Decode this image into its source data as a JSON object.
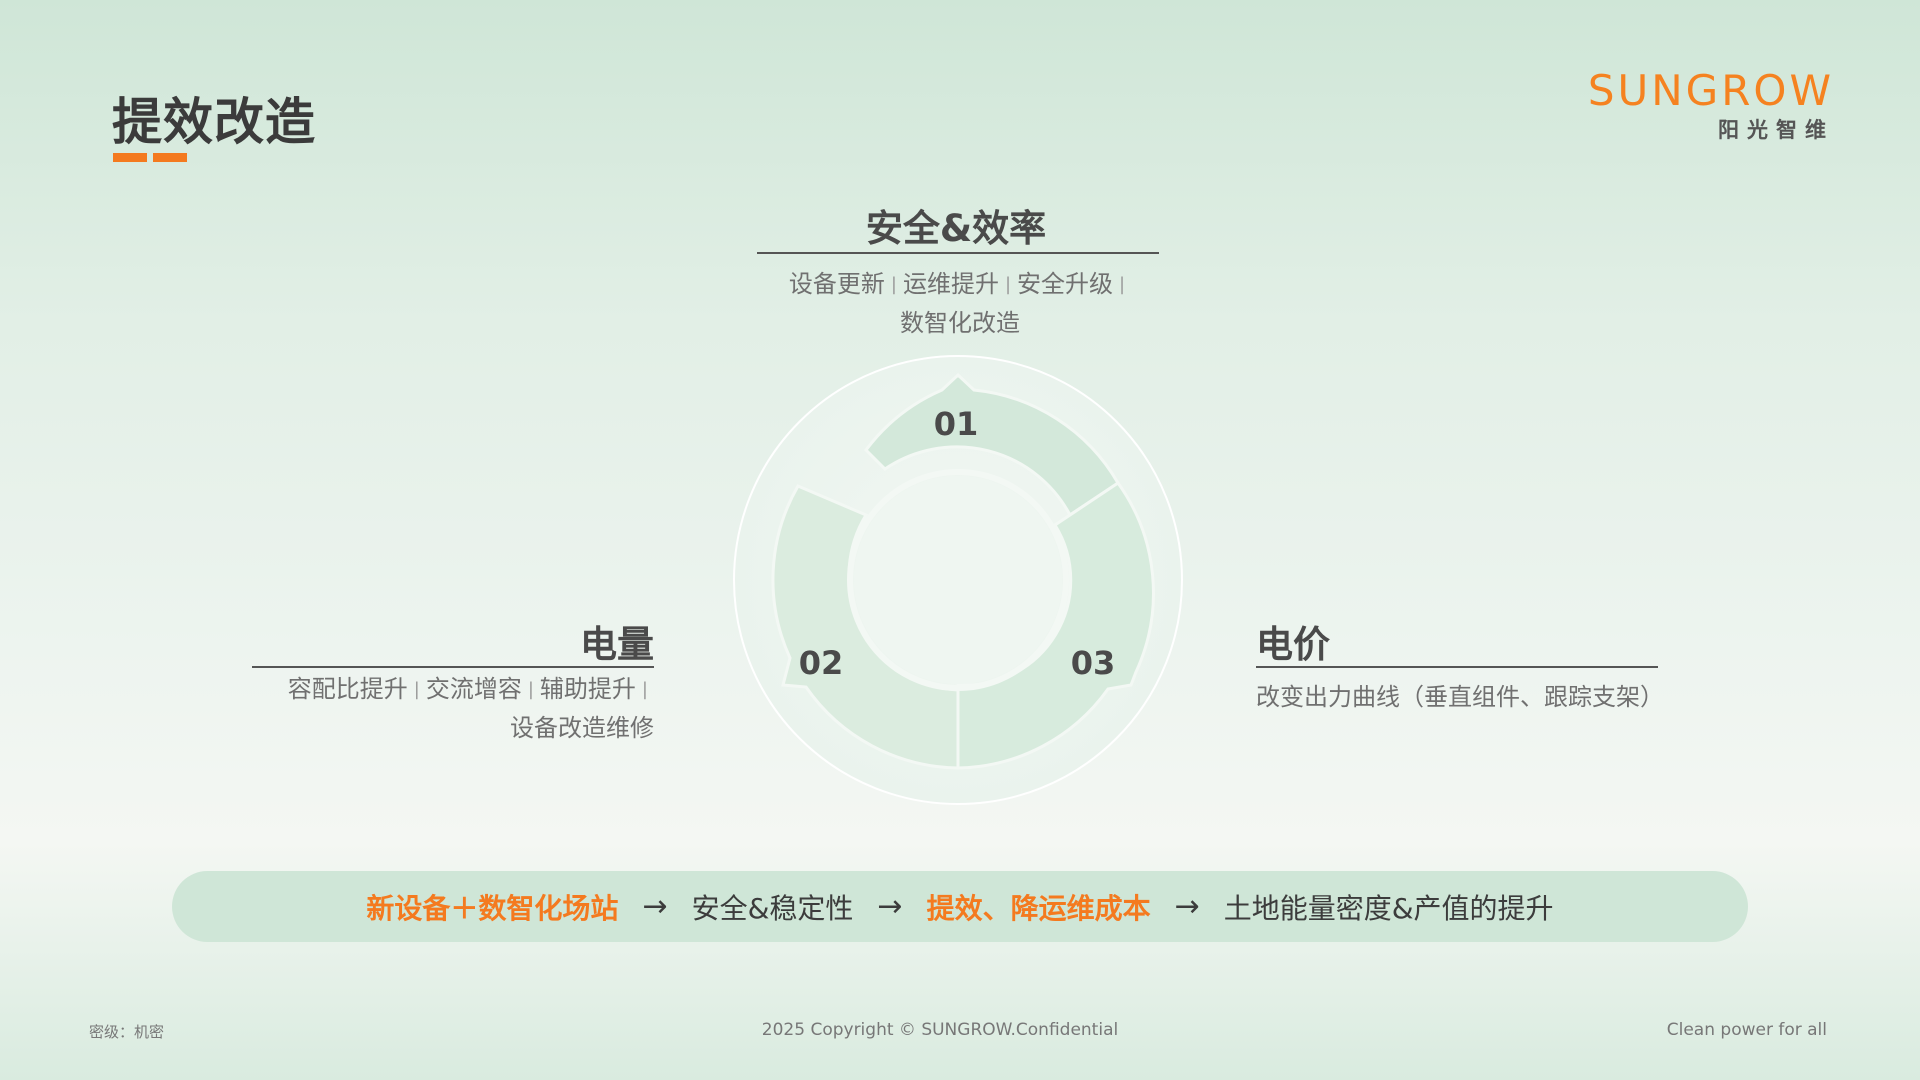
{
  "title": "提效改造",
  "logo": {
    "brand": "SUNGROW",
    "sub": "阳光智维"
  },
  "sections": [
    {
      "number": "01",
      "title": "安全&效率",
      "items": [
        "设备更新",
        "运维提升",
        "安全升级",
        "数智化改造"
      ]
    },
    {
      "number": "02",
      "title": "电量",
      "items": [
        "容配比提升",
        "交流增容",
        "辅助提升",
        "设备改造维修"
      ]
    },
    {
      "number": "03",
      "title": "电价",
      "desc": "改变出力曲线（垂直组件、跟踪支架）"
    }
  ],
  "flow": [
    {
      "text": "新设备＋数智化场站",
      "highlight": true
    },
    {
      "text": "安全&稳定性",
      "highlight": false
    },
    {
      "text": "提效、降运维成本",
      "highlight": true
    },
    {
      "text": "土地能量密度&产值的提升",
      "highlight": false
    }
  ],
  "flow_arrow": "→",
  "footer": {
    "left": "密级：机密",
    "center": "2025 Copyright © SUNGROW.Confidential",
    "right": "Clean power for all"
  },
  "colors": {
    "accent": "#f47a1f",
    "pill": "#cfe6d7",
    "ring_light": "#e6f1ea",
    "ring_mid": "#d4e9dc"
  }
}
